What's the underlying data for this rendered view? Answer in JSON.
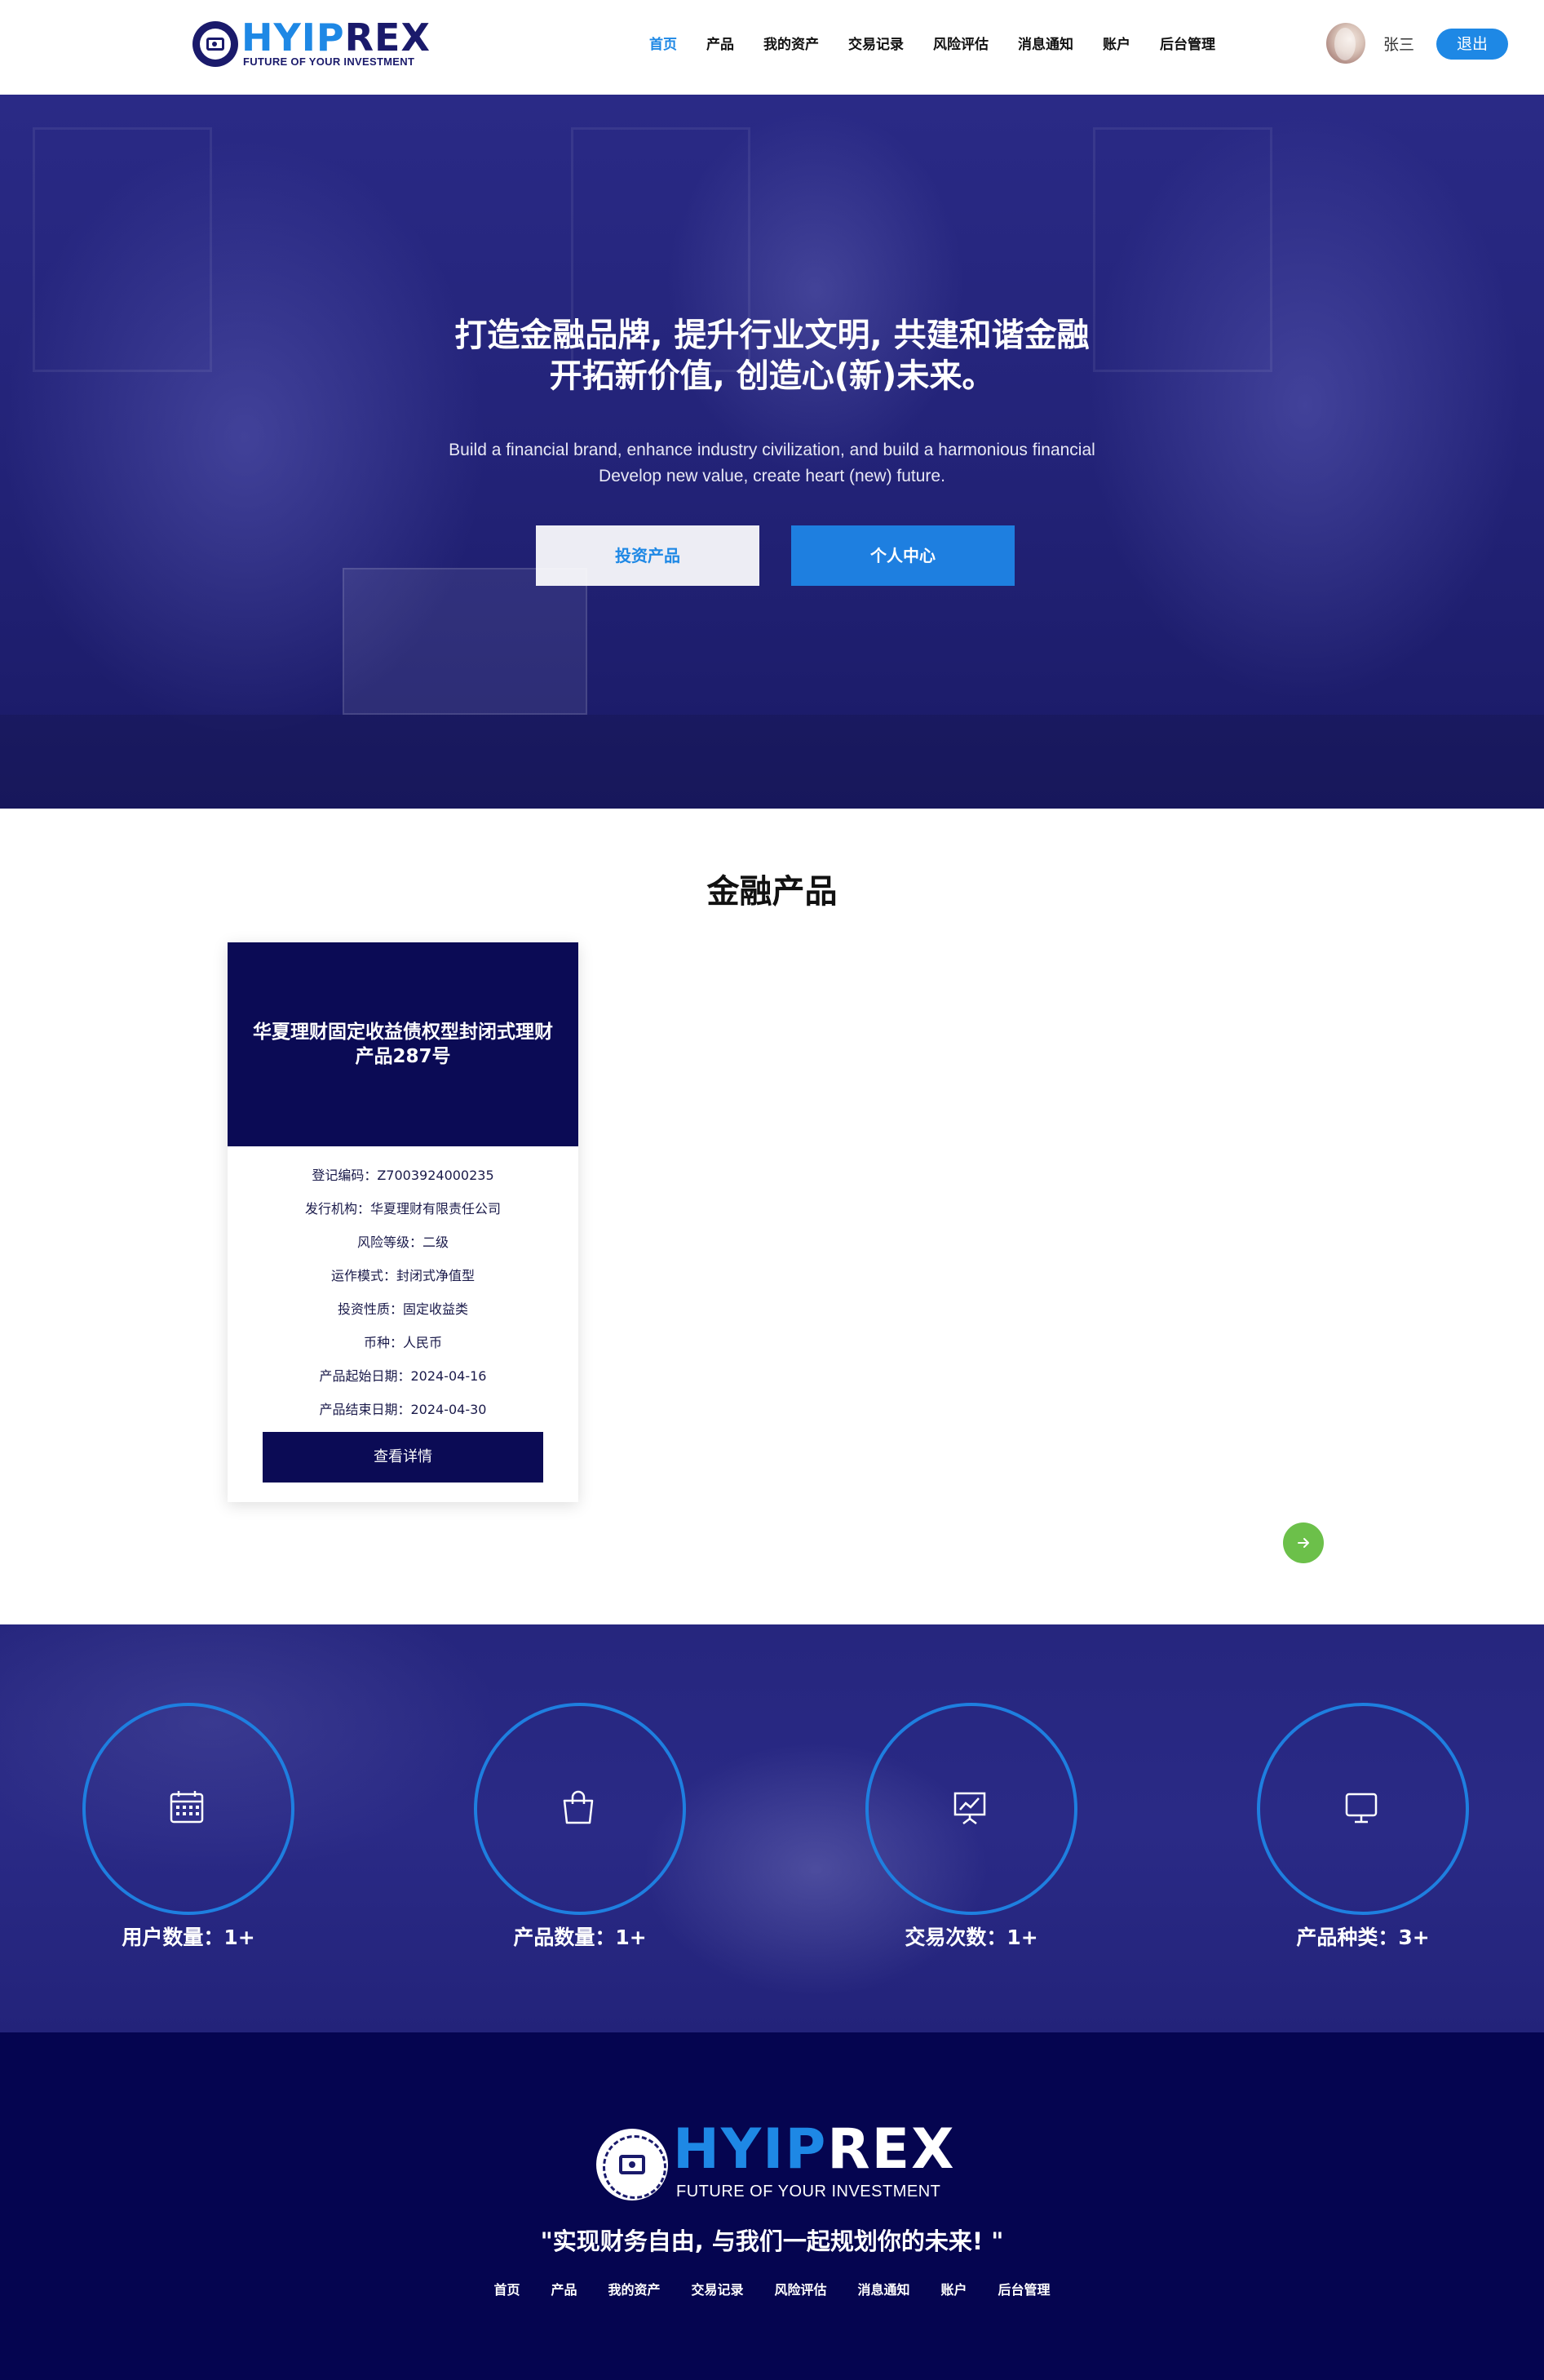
{
  "header": {
    "logo_word_a": "HYIP",
    "logo_word_b": "REX",
    "logo_tagline": "FUTURE OF YOUR INVESTMENT",
    "nav": [
      "首页",
      "产品",
      "我的资产",
      "交易记录",
      "风险评估",
      "消息通知",
      "账户",
      "后台管理"
    ],
    "active_nav": "首页",
    "username": "张三",
    "logout_label": "退出"
  },
  "hero": {
    "title_line1": "打造金融品牌, 提升行业文明, 共建和谐金融",
    "title_line2": "开拓新价值, 创造心(新)未来。",
    "sub_line1": "Build a financial brand, enhance industry civilization, and build a harmonious financial",
    "sub_line2": "Develop new value, create heart (new) future.",
    "invest_button": "投资产品",
    "center_button": "个人中心"
  },
  "products": {
    "section_title": "金融产品",
    "card": {
      "title": "华夏理财固定收益债权型封闭式理财产品287号",
      "rows": [
        "登记编码：Z7003924000235",
        "发行机构：华夏理财有限责任公司",
        "风险等级：二级",
        "运作模式：封闭式净值型",
        "投资性质：固定收益类",
        "币种：人民币",
        "产品起始日期：2024-04-16",
        "产品结束日期：2024-04-30"
      ],
      "button": "查看详情"
    },
    "next_icon": "arrow-right-icon"
  },
  "stats": [
    {
      "label": "用户数量：1+",
      "icon": "calendar-icon"
    },
    {
      "label": "产品数量：1+",
      "icon": "shopping-bag-icon"
    },
    {
      "label": "交易次数：1+",
      "icon": "presentation-chart-icon"
    },
    {
      "label": "产品种类：3+",
      "icon": "monitor-icon"
    }
  ],
  "footer": {
    "logo_word_a": "HYIP",
    "logo_word_b": "REX",
    "logo_tagline": "FUTURE OF YOUR INVESTMENT",
    "slogan": "\"实现财务自由, 与我们一起规划你的未来! \"",
    "nav": [
      "首页",
      "产品",
      "我的资产",
      "交易记录",
      "风险评估",
      "消息通知",
      "账户",
      "后台管理"
    ]
  },
  "colors": {
    "accent": "#1e88e5",
    "navy": "#0b0b55",
    "footer_bg": "#050550",
    "next_button": "#6cc04a"
  }
}
